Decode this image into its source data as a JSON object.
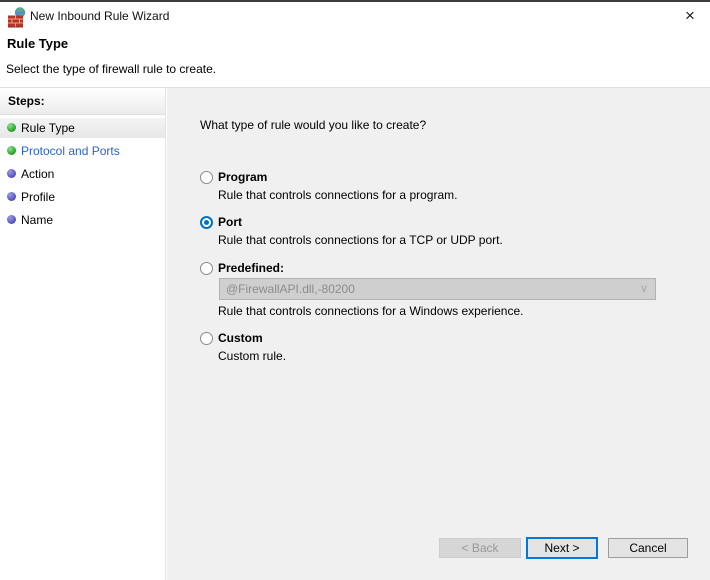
{
  "window": {
    "title": "New Inbound Rule Wizard",
    "icon": "firewall-icon",
    "close_glyph": "×"
  },
  "header": {
    "title": "Rule Type",
    "subtitle": "Select the type of firewall rule to create."
  },
  "sidebar": {
    "heading": "Steps:",
    "items": [
      {
        "label": "Rule Type",
        "bullet": "green",
        "highlight": true,
        "link": false
      },
      {
        "label": "Protocol and Ports",
        "bullet": "green",
        "highlight": false,
        "link": true
      },
      {
        "label": "Action",
        "bullet": "purple",
        "highlight": false,
        "link": false
      },
      {
        "label": "Profile",
        "bullet": "purple",
        "highlight": false,
        "link": false
      },
      {
        "label": "Name",
        "bullet": "purple",
        "highlight": false,
        "link": false
      }
    ]
  },
  "main": {
    "question": "What type of rule would you like to create?",
    "options": [
      {
        "label": "Program",
        "description": "Rule that controls connections for a program.",
        "selected": false
      },
      {
        "label": "Port",
        "description": "Rule that controls connections for a TCP or UDP port.",
        "selected": true
      },
      {
        "label": "Predefined:",
        "description": "Rule that controls connections for a Windows experience.",
        "selected": false,
        "dropdown": {
          "value": "@FirewallAPI.dll,-80200",
          "enabled": false,
          "chevron": "∨"
        }
      },
      {
        "label": "Custom",
        "description": "Custom rule.",
        "selected": false
      }
    ]
  },
  "footer": {
    "back": "< Back",
    "next": "Next >",
    "cancel": "Cancel"
  },
  "colors": {
    "accent_blue": "#0071c2",
    "link_blue": "#2a5fd6",
    "step_green": "#2fa82f",
    "step_purple": "#5a5ac0",
    "content_bg": "#f0f0f0",
    "disabled_field_bg": "#cfcfcf"
  }
}
